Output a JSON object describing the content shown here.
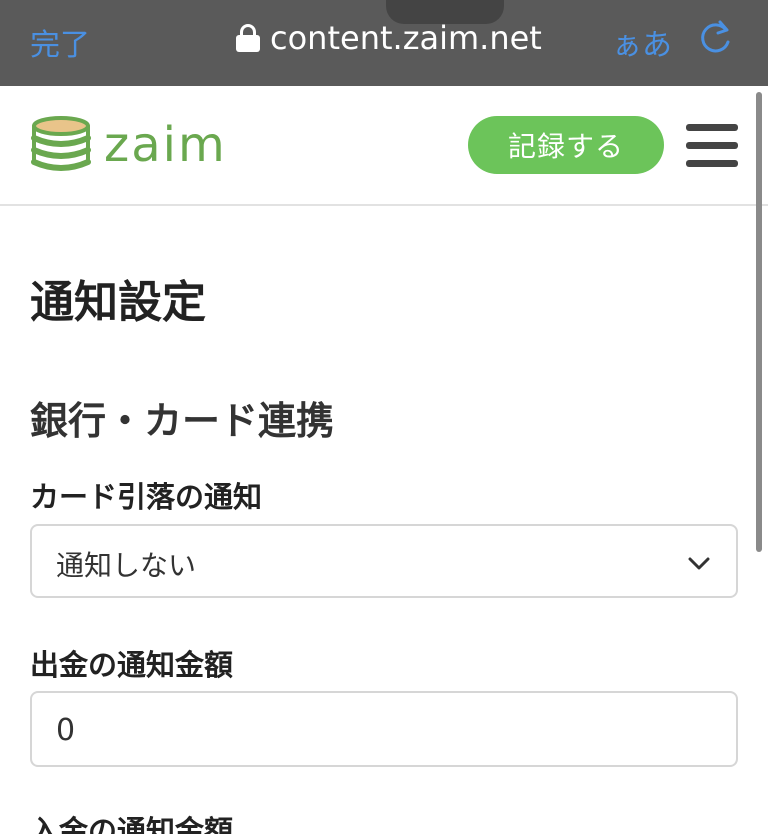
{
  "browser": {
    "done_label": "完了",
    "url": "content.zaim.net",
    "text_size_label": "ぁあ",
    "lock_icon": "lock-icon",
    "reload_icon": "reload-icon"
  },
  "header": {
    "logo_text": "zaim",
    "record_button": "記録する",
    "menu_icon": "hamburger-menu-icon",
    "accent_color": "#6cc45a"
  },
  "main": {
    "page_title": "通知設定",
    "section_title": "銀行・カード連携",
    "fields": [
      {
        "label": "カード引落の通知",
        "type": "select",
        "value": "通知しない"
      },
      {
        "label": "出金の通知金額",
        "type": "input",
        "value": "0"
      },
      {
        "label": "入金の通知金額"
      }
    ]
  }
}
